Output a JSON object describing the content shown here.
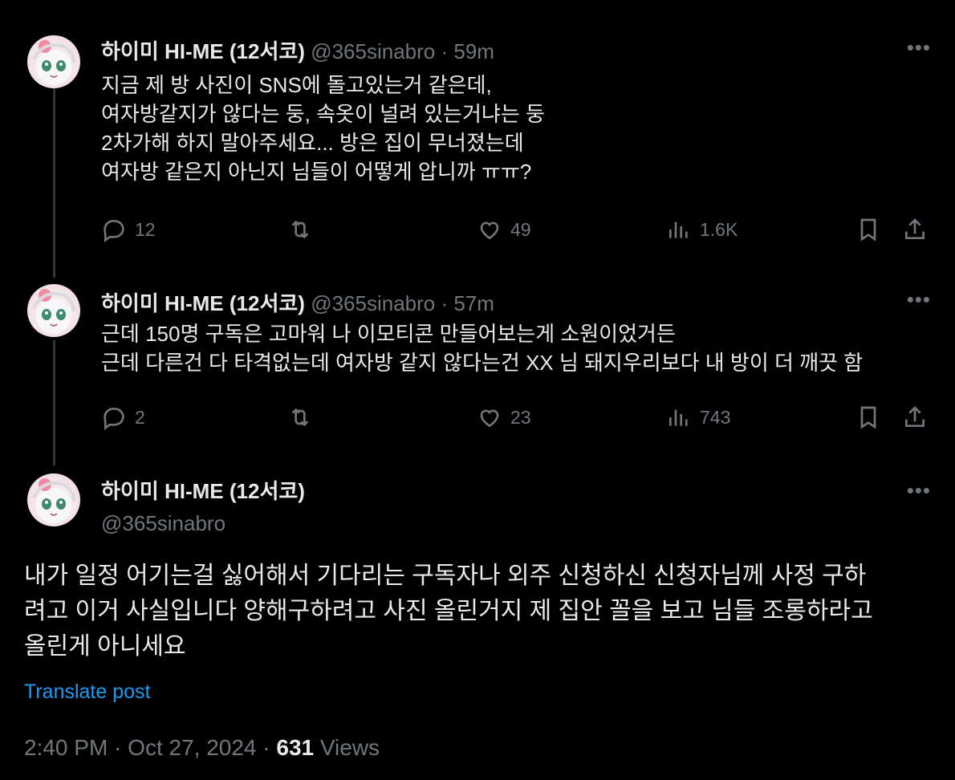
{
  "tweets": [
    {
      "name": "하이미 HI-ME (12서코)",
      "handle": "@365sinabro",
      "time": "59m",
      "lines": [
        "지금 제 방 사진이 SNS에 돌고있는거 같은데,",
        "여자방같지가 않다는 둥, 속옷이 널려 있는거냐는 둥",
        "2차가해 하지 말아주세요... 방은 집이 무너졌는데",
        "여자방 같은지 아닌지 님들이 어떻게 압니까 ㅠㅠ?"
      ],
      "replies": "12",
      "retweets": "",
      "likes": "49",
      "views": "1.6K"
    },
    {
      "name": "하이미 HI-ME (12서코)",
      "handle": "@365sinabro",
      "time": "57m",
      "lines": [
        "근데 150명 구독은 고마워 나 이모티콘 만들어보는게 소원이었거든",
        "근데 다른건 다 타격없는데 여자방 같지 않다는건 XX 님 돼지우리보다 내 방이 더 깨끗 함"
      ],
      "replies": "2",
      "retweets": "",
      "likes": "23",
      "views": "743"
    }
  ],
  "main": {
    "name": "하이미 HI-ME (12서코)",
    "handle": "@365sinabro",
    "lines": [
      "내가 일정 어기는걸 싫어해서 기다리는 구독자나 외주 신청하신 신청자님께 사정 구하",
      "려고 이거 사실입니다 양해구하려고 사진 올린거지 제 집안 꼴을 보고 님들 조롱하라고",
      "올린게 아니세요"
    ],
    "translate": "Translate post",
    "timestamp": "2:40 PM · Oct 27, 2024 · ",
    "views_count": "631",
    "views_label": "Views"
  },
  "icons": {
    "more": "more-icon",
    "reply": "reply-icon",
    "retweet": "retweet-icon",
    "like": "heart-icon",
    "views": "views-icon",
    "bookmark": "bookmark-icon",
    "share": "share-icon"
  },
  "colors": {
    "background": "#000000",
    "text": "#e7e9ea",
    "muted": "#71767b",
    "link": "#1d9bf0"
  }
}
